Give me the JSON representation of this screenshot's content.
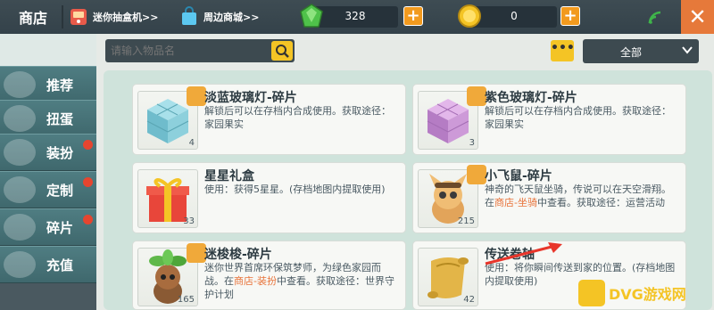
{
  "header": {
    "title": "商店",
    "link1": "迷你抽盒机>>",
    "link2": "周边商城>>",
    "gems": "328",
    "coins": "0",
    "close_icon": "close-icon"
  },
  "sidebar": {
    "items": [
      {
        "label": "推荐",
        "icon": "thumbs-up-icon",
        "badge": false
      },
      {
        "label": "扭蛋",
        "icon": "capsule-icon",
        "badge": false
      },
      {
        "label": "装扮",
        "icon": "shirt-icon",
        "badge": true
      },
      {
        "label": "定制",
        "icon": "customize-icon",
        "badge": true
      },
      {
        "label": "碎片",
        "icon": "fragment-icon",
        "badge": true
      },
      {
        "label": "充值",
        "icon": "coin-stack-icon",
        "badge": false
      }
    ]
  },
  "search": {
    "placeholder": "请输入物品名"
  },
  "filter": {
    "selected": "全部"
  },
  "more_label": "•••",
  "items": [
    {
      "name": "淡蓝玻璃灯-碎片",
      "desc": "解锁后可以在存档内合成使用。获取途径：家园果实",
      "count": "4"
    },
    {
      "name": "紫色玻璃灯-碎片",
      "desc": "解锁后可以在存档内合成使用。获取途径：家园果实",
      "count": "3"
    },
    {
      "name": "星星礼盒",
      "desc": "使用：获得5星星。(存档地图内提取使用)",
      "count": "33"
    },
    {
      "name": "小飞鼠-碎片",
      "desc_a": "神奇的飞天鼠坐骑，传说可以在天空滑翔。在",
      "desc_hl": "商店-坐骑",
      "desc_b": "中查看。获取途径：运营活动",
      "count": "215"
    },
    {
      "name": "迷梭梭-碎片",
      "desc_a": "迷你世界首席环保筑梦师，为绿色家园而战。在",
      "desc_hl": "商店-装扮",
      "desc_b": "中查看。获取途径：世界守护计划",
      "count": "165"
    },
    {
      "name": "传送卷轴",
      "desc": "使用：将你瞬间传送到家的位置。(存档地图内提取使用)",
      "count": "42"
    }
  ],
  "watermark": "DVG游戏网",
  "colors": {
    "accent": "#f4c425",
    "orange": "#e6793a",
    "badge": "#e6452f"
  }
}
